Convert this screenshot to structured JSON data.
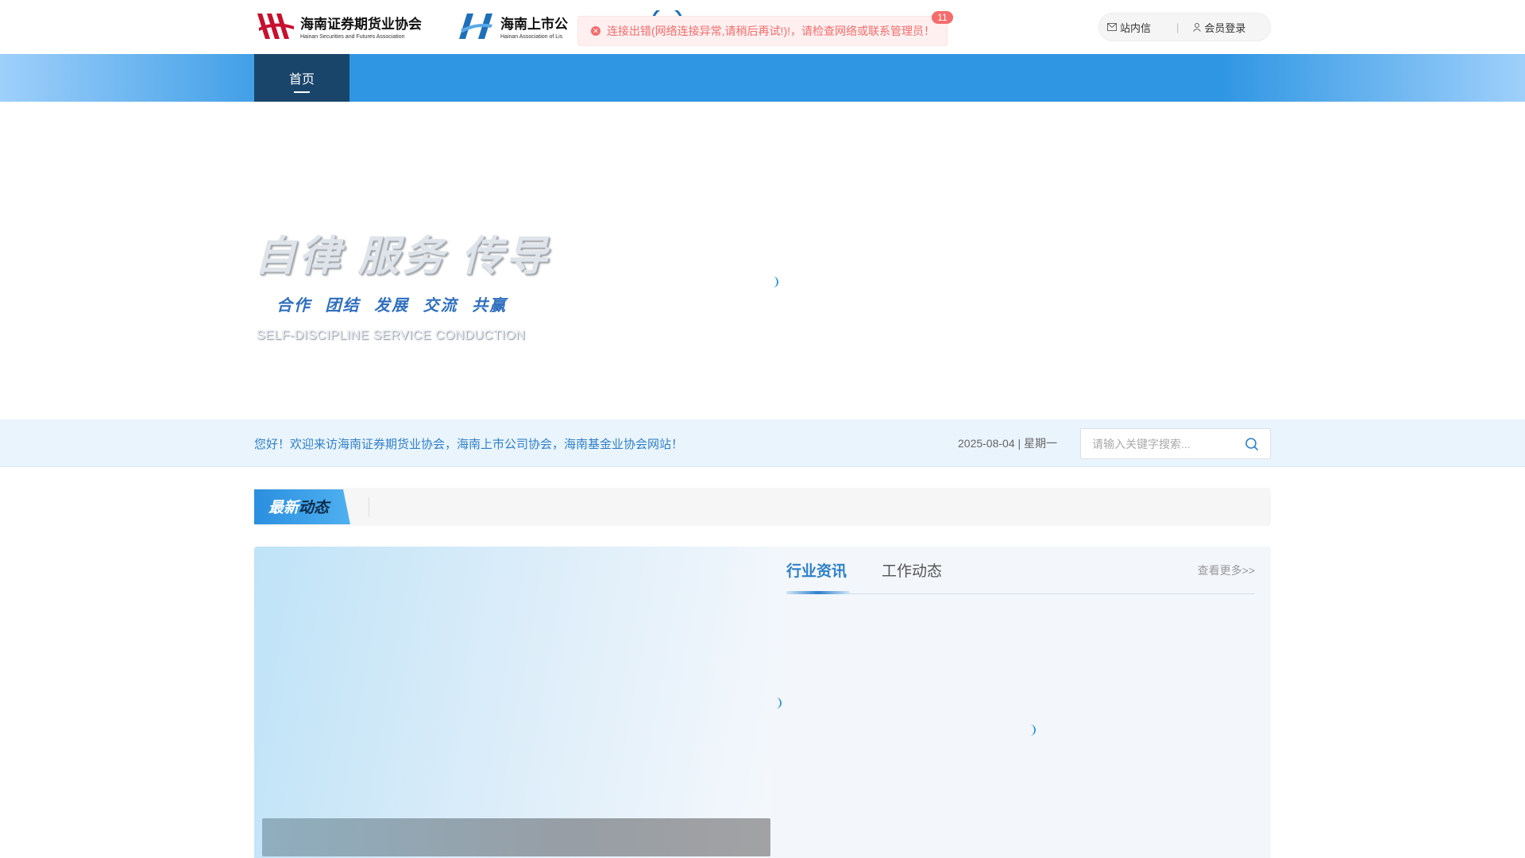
{
  "header": {
    "logos": [
      {
        "name_cn": "海南证券期货业协会",
        "name_en": "Hainan Securities and Futures Association",
        "color": "#c8102e"
      },
      {
        "name_cn": "海南上市公",
        "name_en": "Hainan Association of Lis",
        "color": "#1f6fb8"
      }
    ],
    "user_links": {
      "messages": "站内信",
      "separator": "|",
      "login": "会员登录"
    }
  },
  "toast": {
    "message": "连接出错(网络连接异常,请稍后再试!)!，请检查网络或联系管理员！",
    "count": "11"
  },
  "nav": {
    "home": "首页"
  },
  "banner": {
    "slogan_cn": "自律 服务 传导",
    "slogan_sub": "合作 团结 发展 交流 共赢",
    "slogan_en": "SELF-DISCIPLINE  SERVICE  CONDUCTION"
  },
  "welcome": {
    "text": "您好！欢迎来访海南证券期货业协会，海南上市公司协会，海南基金业协会网站！",
    "date": "2025-08-04 | 星期一"
  },
  "search": {
    "placeholder": "请输入关键字搜索...",
    "value": ""
  },
  "latest": {
    "label_light": "最新",
    "label_dark": "动态"
  },
  "news": {
    "tabs": [
      {
        "label": "行业资讯"
      },
      {
        "label": "工作动态"
      }
    ],
    "more": "查看更多>>"
  },
  "colors": {
    "primary": "#2f96e3",
    "nav_dark": "#1a456b",
    "error": "#f56c6c"
  }
}
